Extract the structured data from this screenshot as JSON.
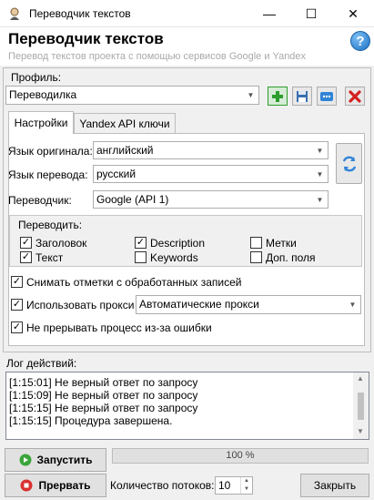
{
  "window": {
    "title": "Переводчик текстов"
  },
  "header": {
    "title": "Переводчик текстов",
    "subtitle": "Перевод текстов проекта с помощью сервисов Google и Yandex"
  },
  "profile": {
    "label": "Профиль:",
    "value": "Переводилка"
  },
  "tabs": [
    {
      "label": "Настройки"
    },
    {
      "label": "Yandex API ключи"
    }
  ],
  "settings": {
    "source_lang_label": "Язык оригинала:",
    "source_lang_value": "английский",
    "target_lang_label": "Язык перевода:",
    "target_lang_value": "русский",
    "translator_label": "Переводчик:",
    "translator_value": "Google (API 1)"
  },
  "translate_group": {
    "title": "Переводить:",
    "items": [
      {
        "label": "Заголовок",
        "checked": true
      },
      {
        "label": "Текст",
        "checked": true
      },
      {
        "label": "Description",
        "checked": true
      },
      {
        "label": "Keywords",
        "checked": false
      },
      {
        "label": "Метки",
        "checked": false
      },
      {
        "label": "Доп. поля",
        "checked": false
      }
    ]
  },
  "options": {
    "uncheck_processed": {
      "label": "Снимать отметки с обработанных записей",
      "checked": true
    },
    "use_proxy": {
      "label": "Использовать прокси",
      "checked": true,
      "value": "Автоматические прокси"
    },
    "no_interrupt": {
      "label": "Не прерывать процесс из-за ошибки",
      "checked": true
    }
  },
  "log": {
    "label": "Лог действий:",
    "lines": [
      "[1:15:01] Не верный ответ по запросу",
      "[1:15:09] Не верный ответ по запросу",
      "[1:15:15] Не верный ответ по запросу",
      "[1:15:15] Процедура завершена."
    ]
  },
  "bottom": {
    "start_label": "Запустить",
    "stop_label": "Прервать",
    "progress_text": "100 %",
    "progress_fraction": 1.0,
    "threads_label": "Количество потоков:",
    "threads_value": "10",
    "close_label": "Закрыть"
  },
  "colors": {
    "add_green": "#2e9d2e",
    "delete_red": "#d42020",
    "stop_red": "#d93030",
    "start_green": "#3aa53a",
    "help_blue": "#1a6fc4"
  }
}
